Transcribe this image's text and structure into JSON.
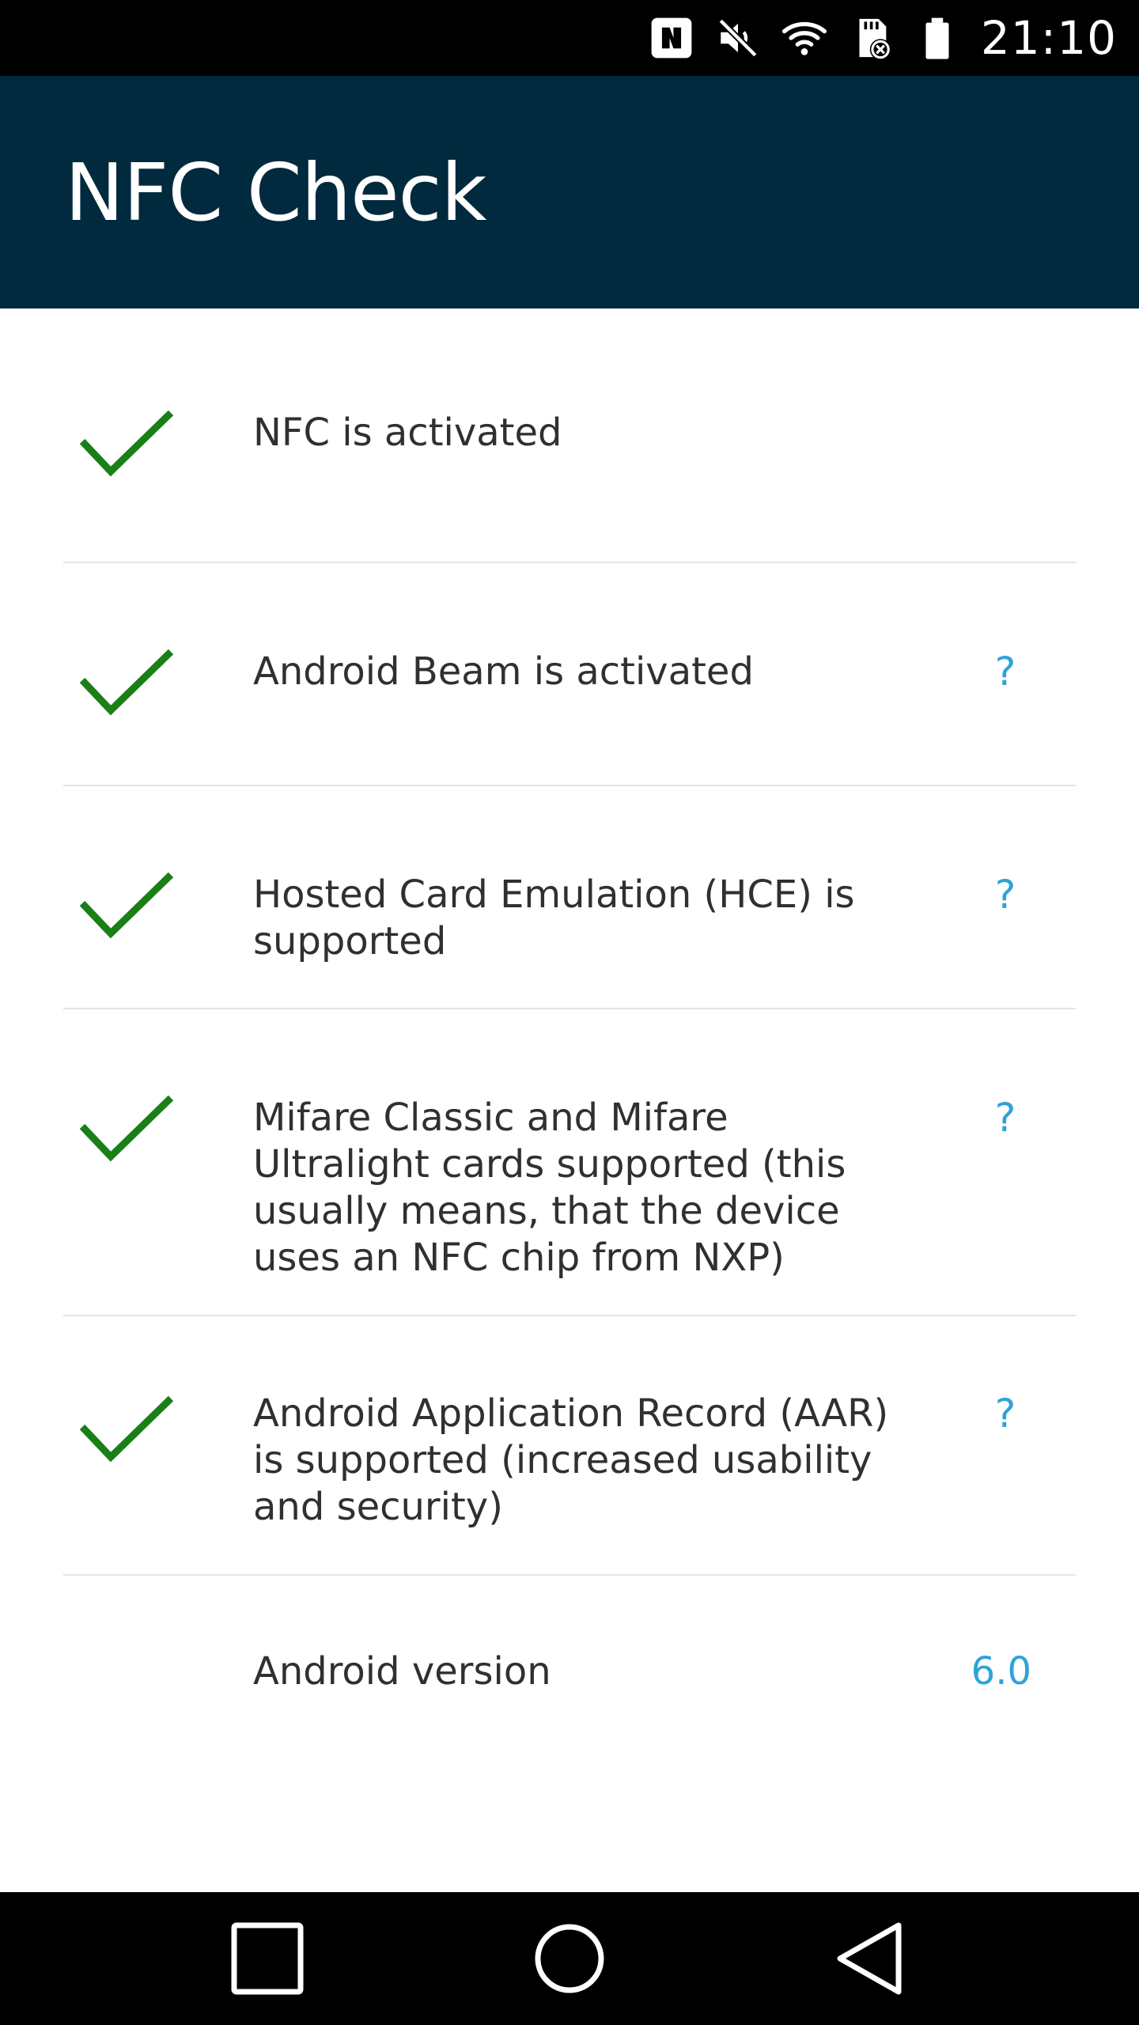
{
  "status_bar": {
    "time": "21:10",
    "icons": [
      "nfc-icon",
      "muted-icon",
      "wifi-icon",
      "sd-card-icon",
      "battery-icon"
    ]
  },
  "app_bar": {
    "title": "NFC Check",
    "background": "#012a3e"
  },
  "checks": [
    {
      "text": "NFC is activated",
      "status": "check-icon",
      "has_help": false
    },
    {
      "text": "Android Beam is activated",
      "status": "check-icon",
      "has_help": true,
      "help_label": "?"
    },
    {
      "text": "Hosted Card Emulation (HCE) is\nsupported",
      "status": "check-icon",
      "has_help": true,
      "help_label": "?"
    },
    {
      "text": "Mifare Classic and Mifare\nUltralight cards supported (this\nusually means, that the device\nuses an NFC chip from NXP)",
      "status": "check-icon",
      "has_help": true,
      "help_label": "?"
    },
    {
      "text": "Android Application Record (AAR)\nis supported (increased usability\nand security)",
      "status": "check-icon",
      "has_help": true,
      "help_label": "?"
    }
  ],
  "version": {
    "label": "Android version",
    "value": "6.0"
  },
  "colors": {
    "check": "#1a7f17",
    "accent": "#2ea3d9"
  },
  "nav_bar": {
    "buttons": [
      "recents-icon",
      "home-icon",
      "back-icon"
    ]
  }
}
